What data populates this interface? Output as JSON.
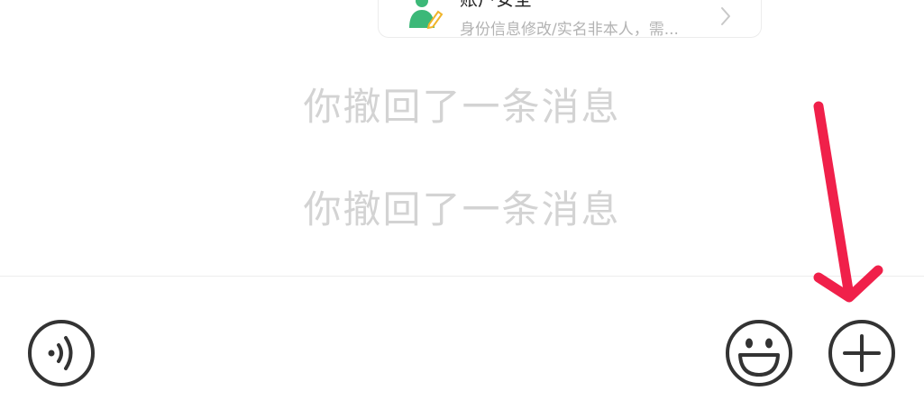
{
  "card": {
    "title": "账户安全",
    "subtitle": "身份信息修改/实名非本人，需..."
  },
  "messages": [
    {
      "text": "你撤回了一条消息"
    },
    {
      "text": "你撤回了一条消息"
    }
  ],
  "toolbar": {
    "voice_icon": "voice-icon",
    "emoji_icon": "emoji-icon",
    "plus_icon": "plus-icon"
  },
  "colors": {
    "notice_text": "#d3d3d3",
    "icon_stroke": "#333333",
    "card_icon_green": "#3cb878",
    "arrow": "#f0204a"
  }
}
